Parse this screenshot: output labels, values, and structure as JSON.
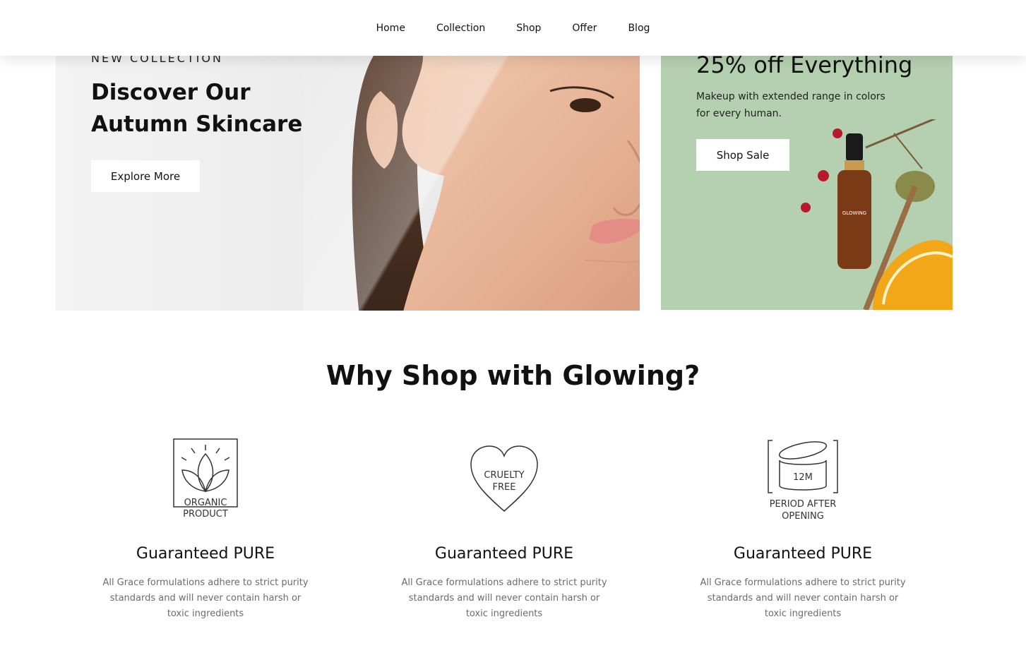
{
  "nav": {
    "items": [
      "Home",
      "Collection",
      "Shop",
      "Offer",
      "Blog"
    ]
  },
  "hero": {
    "eyebrow": "NEW COLLECTION",
    "title_line1": "Discover Our",
    "title_line2": "Autumn Skincare",
    "button": "Explore More"
  },
  "offer": {
    "title": "25% off Everything",
    "text": "Makeup with extended range in colors for every human.",
    "button": "Shop Sale",
    "bottle_label": "GLOWING"
  },
  "why": {
    "title": "Why Shop with Glowing?",
    "features": [
      {
        "icon": "organic-product-icon",
        "icon_text1": "ORGANIC",
        "icon_text2": "PRODUCT",
        "heading": "Guaranteed PURE",
        "text": "All Grace formulations adhere to strict purity standards and will never contain harsh or toxic ingredients"
      },
      {
        "icon": "cruelty-free-icon",
        "icon_text1": "CRUELTY",
        "icon_text2": "FREE",
        "heading": "Guaranteed PURE",
        "text": "All Grace formulations adhere to strict purity standards and will never contain harsh or toxic ingredients"
      },
      {
        "icon": "period-after-opening-icon",
        "icon_text0": "12M",
        "icon_text1": "PERIOD AFTER",
        "icon_text2": "OPENING",
        "heading": "Guaranteed PURE",
        "text": "All Grace formulations adhere to strict purity standards and will never contain harsh or toxic ingredients"
      }
    ]
  },
  "colors": {
    "offer_bg": "#b5d0b0",
    "hero_bg": "#efefef",
    "text": "#111111",
    "muted": "#6b6b6b"
  }
}
